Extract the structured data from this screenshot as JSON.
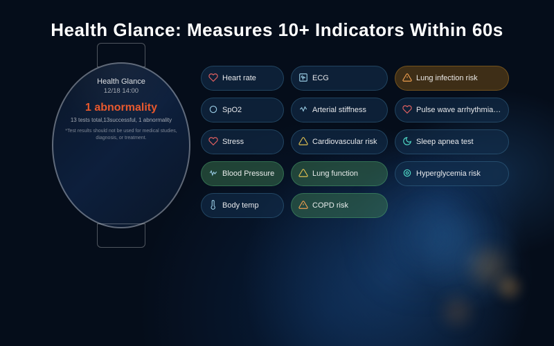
{
  "page": {
    "title": "Health Glance: Measures 10+ Indicators Within 60s"
  },
  "watch": {
    "label": "Health Glance",
    "date": "12/18 14:00",
    "abnormality_count": "1 abnormality",
    "tests_summary": "13 tests total,13successful, 1 abnormality",
    "disclaimer": "*Test results should not be used for medical studies, diagnosis, or treatment."
  },
  "indicators": [
    {
      "id": "heart-rate",
      "icon": "♡",
      "icon_class": "red",
      "text": "Heart rate",
      "col": 1,
      "highlight": ""
    },
    {
      "id": "ecg",
      "icon": "📋",
      "icon_class": "",
      "text": "ECG",
      "col": 2,
      "highlight": ""
    },
    {
      "id": "lung-infection",
      "icon": "⚠",
      "icon_class": "orange",
      "text": "Lung infection risk",
      "col": 3,
      "highlight": "highlight-amber"
    },
    {
      "id": "spo2",
      "icon": "○",
      "icon_class": "",
      "text": "SpO2",
      "col": 1,
      "highlight": ""
    },
    {
      "id": "arterial-stiffness",
      "icon": "〜",
      "icon_class": "",
      "text": "Arterial stiffness",
      "col": 2,
      "highlight": ""
    },
    {
      "id": "pulse-wave",
      "icon": "♡",
      "icon_class": "red",
      "text": "Pulse wave arrhythmia analysis",
      "col": 3,
      "highlight": ""
    },
    {
      "id": "stress",
      "icon": "♡",
      "icon_class": "red",
      "text": "Stress",
      "col": 1,
      "highlight": ""
    },
    {
      "id": "cardiovascular",
      "icon": "△",
      "icon_class": "yellow",
      "text": "Cardiovascular risk",
      "col": 2,
      "highlight": ""
    },
    {
      "id": "sleep-apnea",
      "icon": "☾",
      "icon_class": "teal",
      "text": "Sleep apnea test",
      "col": 3,
      "highlight": ""
    },
    {
      "id": "blood-pressure",
      "icon": "〜",
      "icon_class": "",
      "text": "Blood Pressure",
      "col": 1,
      "highlight": "highlight"
    },
    {
      "id": "lung-function",
      "icon": "△",
      "icon_class": "yellow",
      "text": "Lung function",
      "col": 2,
      "highlight": "highlight"
    },
    {
      "id": "hyperglycemia",
      "icon": "◎",
      "icon_class": "teal",
      "text": "Hyperglycemia risk",
      "col": 3,
      "highlight": ""
    },
    {
      "id": "body-temp",
      "icon": "🌡",
      "icon_class": "",
      "text": "Body temp",
      "col": 1,
      "highlight": ""
    },
    {
      "id": "copd-risk",
      "icon": "⚠",
      "icon_class": "orange",
      "text": "COPD risk",
      "col": 2,
      "highlight": "highlight"
    }
  ]
}
